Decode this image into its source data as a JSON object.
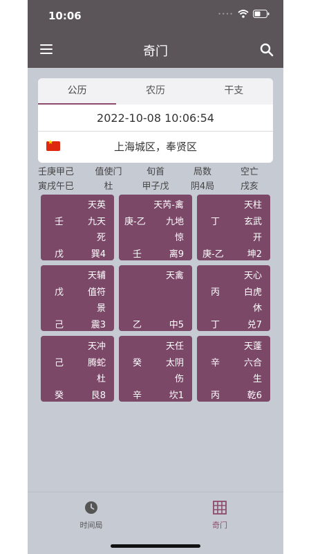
{
  "status_bar": {
    "time": "10:06"
  },
  "nav": {
    "title": "奇门",
    "menu_icon": "hamburger-menu-icon",
    "search_icon": "search-icon"
  },
  "tabs": [
    {
      "label": "公历",
      "active": true
    },
    {
      "label": "农历",
      "active": false
    },
    {
      "label": "干支",
      "active": false
    }
  ],
  "datetime": "2022-10-08 10:06:54",
  "location": {
    "flag": "china-flag-icon",
    "city": "上海城区，奉贤区"
  },
  "info": {
    "headers": [
      "壬庚甲己",
      "值使门",
      "旬首",
      "局数",
      "空亡"
    ],
    "values": [
      "寅戌午巳",
      "杜",
      "甲子戊",
      "阴4局",
      "戌亥"
    ]
  },
  "palaces": [
    {
      "star": "天英",
      "left": "壬",
      "god": "九天",
      "door": "死",
      "bl": "戊",
      "br": "巽4"
    },
    {
      "star": "天芮-禽",
      "left": "庚-乙",
      "god": "九地",
      "door": "惊",
      "bl": "壬",
      "br": "离9"
    },
    {
      "star": "天柱",
      "left": "丁",
      "god": "玄武",
      "door": "开",
      "bl": "庚-乙",
      "br": "坤2"
    },
    {
      "star": "天辅",
      "left": "戊",
      "god": "值符",
      "door": "景",
      "bl": "己",
      "br": "震3"
    },
    {
      "star": "天禽",
      "left": "",
      "god": "",
      "door": "",
      "bl": "乙",
      "br": "中5"
    },
    {
      "star": "天心",
      "left": "丙",
      "god": "白虎",
      "door": "休",
      "bl": "丁",
      "br": "兑7"
    },
    {
      "star": "天冲",
      "left": "己",
      "god": "腾蛇",
      "door": "杜",
      "bl": "癸",
      "br": "艮8"
    },
    {
      "star": "天任",
      "left": "癸",
      "god": "太阴",
      "door": "伤",
      "bl": "辛",
      "br": "坎1"
    },
    {
      "star": "天蓬",
      "left": "辛",
      "god": "六合",
      "door": "生",
      "bl": "丙",
      "br": "乾6"
    }
  ],
  "bottom_tabs": [
    {
      "label": "时间局",
      "icon": "clock-icon",
      "color": "#555555"
    },
    {
      "label": "奇门",
      "icon": "grid-icon",
      "color": "#8d4a6d"
    }
  ]
}
